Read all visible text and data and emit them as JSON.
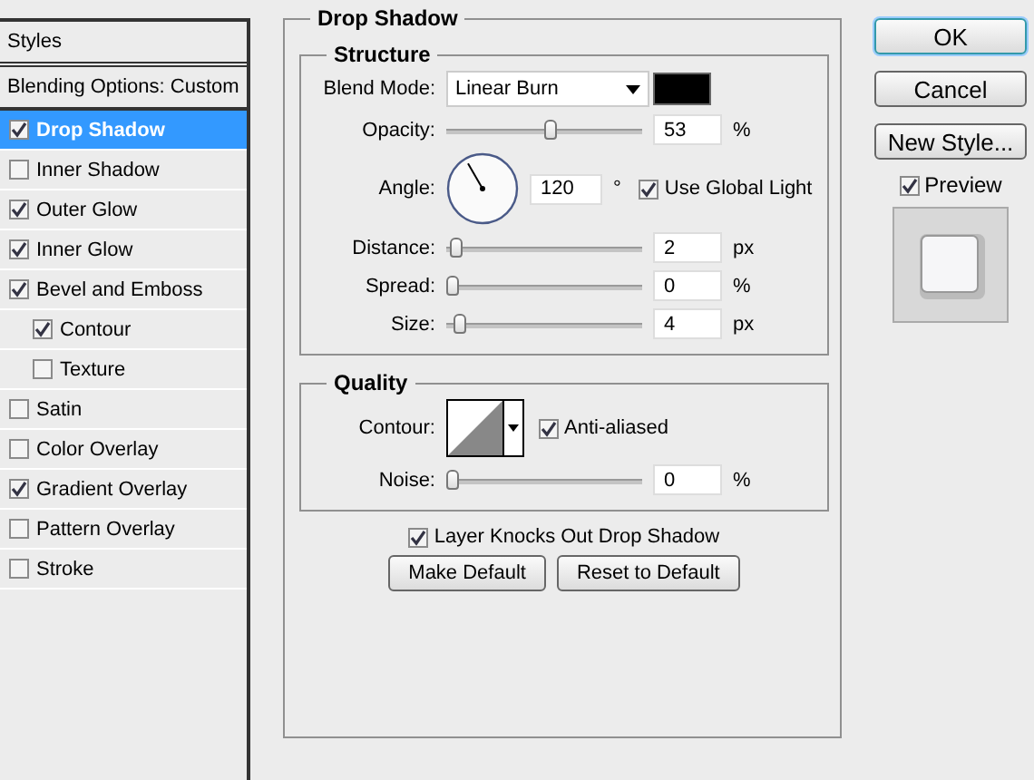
{
  "styles_panel": {
    "title": "Styles",
    "blending_options": "Blending Options: Custom",
    "items": [
      {
        "label": "Drop Shadow",
        "checked": true,
        "selected": true
      },
      {
        "label": "Inner Shadow",
        "checked": false,
        "selected": false
      },
      {
        "label": "Outer Glow",
        "checked": true,
        "selected": false
      },
      {
        "label": "Inner Glow",
        "checked": true,
        "selected": false
      },
      {
        "label": "Bevel and Emboss",
        "checked": true,
        "selected": false,
        "children": [
          {
            "label": "Contour",
            "checked": true,
            "selected": false
          },
          {
            "label": "Texture",
            "checked": false,
            "selected": false
          }
        ]
      },
      {
        "label": "Satin",
        "checked": false,
        "selected": false
      },
      {
        "label": "Color Overlay",
        "checked": false,
        "selected": false
      },
      {
        "label": "Gradient Overlay",
        "checked": true,
        "selected": false
      },
      {
        "label": "Pattern Overlay",
        "checked": false,
        "selected": false
      },
      {
        "label": "Stroke",
        "checked": false,
        "selected": false
      }
    ]
  },
  "drop_shadow": {
    "title": "Drop Shadow",
    "structure": {
      "title": "Structure",
      "blend_mode": {
        "label": "Blend Mode:",
        "value": "Linear Burn"
      },
      "opacity": {
        "label": "Opacity:",
        "level": 0.53,
        "value": "53",
        "unit": "%"
      },
      "angle": {
        "label": "Angle:",
        "value": "120",
        "unit": "°",
        "global_light": {
          "label": "Use Global Light",
          "checked": true
        }
      },
      "sliders": [
        {
          "label": "Distance:",
          "level": 0.02,
          "value": "2",
          "unit": "px"
        },
        {
          "label": "Spread:",
          "level": 0,
          "value": "0",
          "unit": "%"
        },
        {
          "label": "Size:",
          "level": 0.04,
          "value": "4",
          "unit": "px"
        }
      ]
    },
    "quality": {
      "title": "Quality",
      "contour": {
        "label": "Contour:"
      },
      "anti_aliased": {
        "label": "Anti-aliased",
        "checked": true
      },
      "noise": {
        "label": "Noise:",
        "level": 0,
        "value": "0",
        "unit": "%"
      }
    },
    "layer_knocks_out": {
      "label": "Layer Knocks Out Drop Shadow",
      "checked": true
    },
    "buttons": [
      "Make Default",
      "Reset to Default"
    ]
  },
  "actions": {
    "buttons": [
      {
        "label": "OK",
        "kind": "default"
      },
      {
        "label": "Cancel",
        "kind": "normal"
      },
      {
        "label": "New Style...",
        "kind": "normal"
      }
    ],
    "preview": {
      "label": "Preview",
      "checked": true
    }
  }
}
